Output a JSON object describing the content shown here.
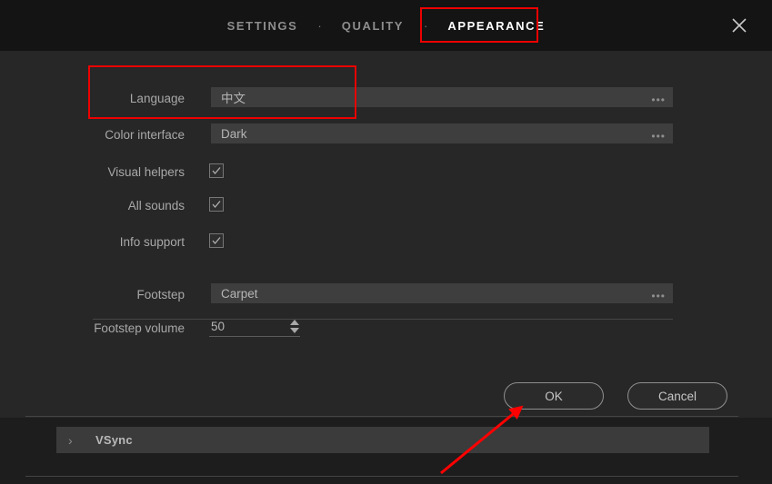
{
  "header": {
    "tabs": [
      {
        "label": "SETTINGS",
        "active": false
      },
      {
        "label": "QUALITY",
        "active": false
      },
      {
        "label": "APPEARANCE",
        "active": true
      }
    ],
    "separator": "·",
    "close_icon": "close-icon"
  },
  "form": {
    "language": {
      "label": "Language",
      "value": "中文",
      "ellipsis": "•••"
    },
    "color_interface": {
      "label": "Color interface",
      "value": "Dark",
      "ellipsis": "•••"
    },
    "visual_helpers": {
      "label": "Visual helpers",
      "checked": true
    },
    "all_sounds": {
      "label": "All sounds",
      "checked": true
    },
    "info_support": {
      "label": "Info support",
      "checked": true
    },
    "footstep": {
      "label": "Footstep",
      "value": "Carpet",
      "ellipsis": "•••"
    },
    "footstep_volume": {
      "label": "Footstep volume",
      "value": "50"
    }
  },
  "buttons": {
    "ok": "OK",
    "cancel": "Cancel"
  },
  "background": {
    "vsync_row": {
      "chevron": "›",
      "label": "VSync"
    }
  },
  "annotations": {
    "highlight_color": "#ee0000",
    "arrow_color": "#ff0000",
    "language_box": "language-row-highlight",
    "appearance_box": "appearance-tab-highlight",
    "arrow": "pointer-arrow-to-ok-button"
  }
}
